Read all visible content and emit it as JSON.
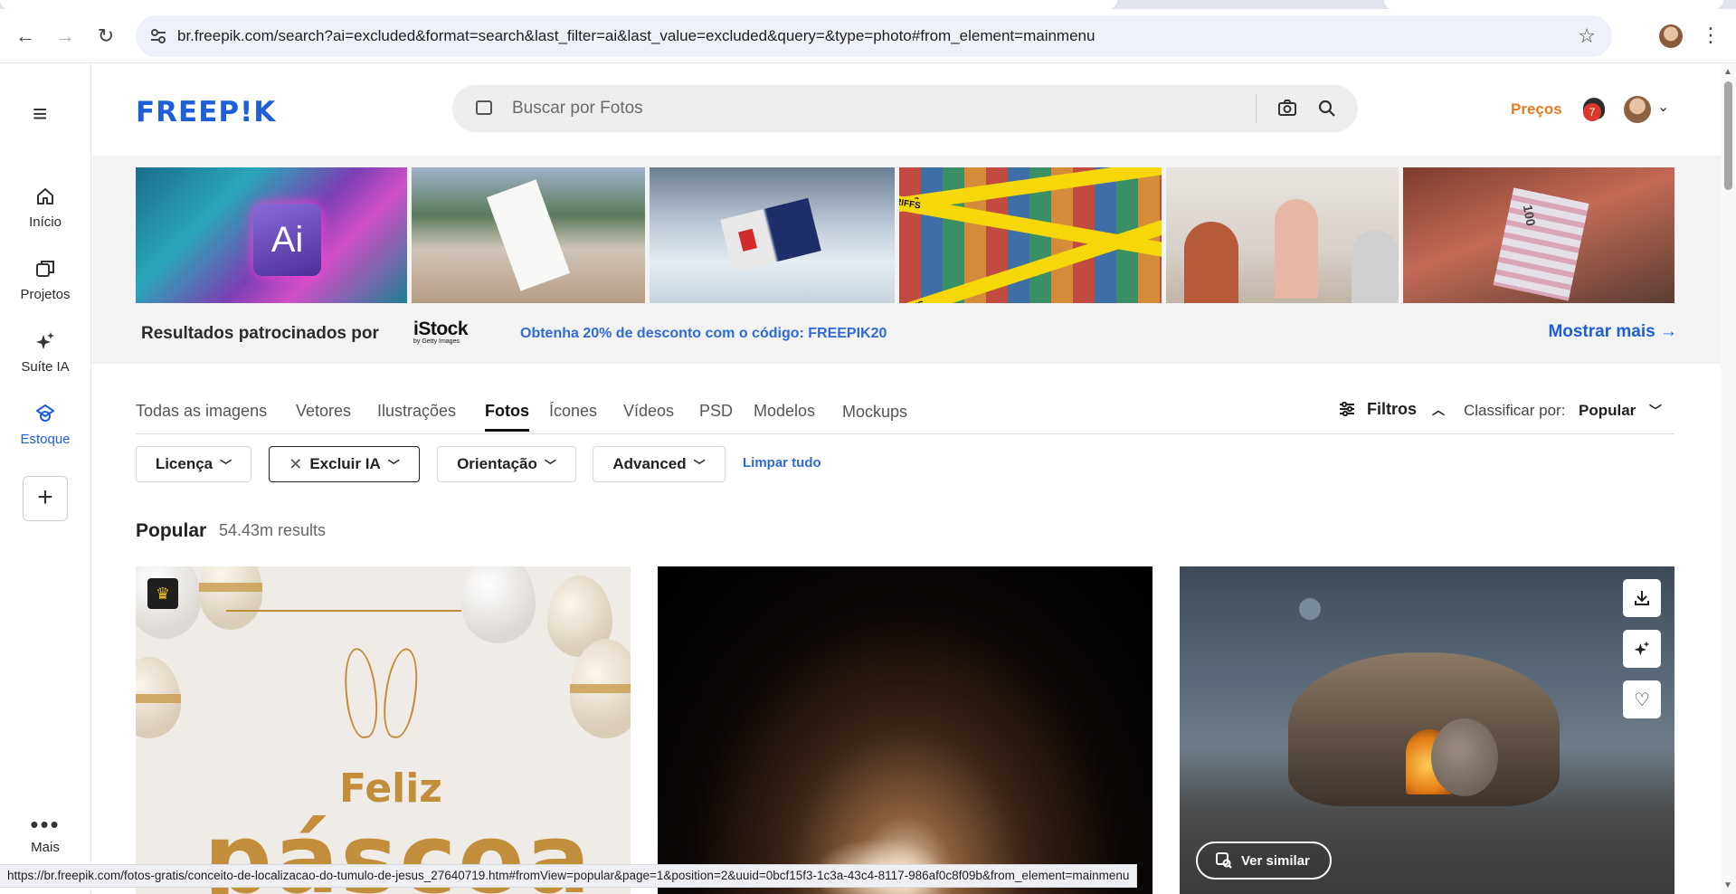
{
  "browser": {
    "url": "br.freepik.com/search?ai=excluded&format=search&last_filter=ai&last_value=excluded&query=&type=photo#from_element=mainmenu",
    "status_url": "https://br.freepik.com/fotos-gratis/conceito-de-localizacao-do-tumulo-de-jesus_27640719.htm#fromView=popular&page=1&position=2&uuid=0bcf15f3-1c3a-43c4-8117-986af0c8f09b&from_element=mainmenu",
    "icons": [
      "back-icon",
      "forward-icon",
      "reload-icon",
      "site-settings-icon",
      "bookmark-star-icon",
      "profile-icon",
      "kebab-menu-icon"
    ]
  },
  "sidebar": {
    "items": [
      {
        "label": "Início",
        "icon": "home-icon"
      },
      {
        "label": "Projetos",
        "icon": "projects-icon"
      },
      {
        "label": "Suíte IA",
        "icon": "sparkle-icon"
      },
      {
        "label": "Estoque",
        "icon": "stock-icon"
      }
    ],
    "more_label": "Mais"
  },
  "header": {
    "logo": "FREEP!K",
    "search_placeholder": "Buscar por Fotos",
    "precos": "Preços",
    "notification_count": "7"
  },
  "sponsored": {
    "label": "Resultados patrocinados por",
    "sponsor_brand": "iStock",
    "sponsor_sub": "by Getty Images",
    "promo": "Obtenha 20% de desconto com o código: FREEPIK20",
    "more": "Mostrar mais",
    "ad_text": [
      "Ai",
      "TARIFFS",
      "100"
    ]
  },
  "type_tabs": [
    {
      "label": "Todas as imagens",
      "active": false
    },
    {
      "label": "Vetores",
      "active": false
    },
    {
      "label": "Ilustrações",
      "active": false
    },
    {
      "label": "Fotos",
      "active": true
    },
    {
      "label": "Ícones",
      "active": false
    },
    {
      "label": "Vídeos",
      "active": false
    },
    {
      "label": "PSD",
      "active": false
    },
    {
      "label": "Modelos",
      "active": false
    },
    {
      "label": "Mockups",
      "active": false
    }
  ],
  "filters_bar": {
    "filtros": "Filtros",
    "sort_label": "Classificar por:",
    "sort_value": "Popular"
  },
  "filter_chips": [
    {
      "label": "Licença",
      "selected": false
    },
    {
      "label": "Excluir IA",
      "selected": true
    },
    {
      "label": "Orientação",
      "selected": false
    },
    {
      "label": "Advanced",
      "selected": false
    }
  ],
  "clear_all": "Limpar tudo",
  "results": {
    "title": "Popular",
    "count": "54.43m results"
  },
  "cards": [
    {
      "heading": "Feliz",
      "headline": "páscoa"
    },
    {},
    {
      "ver_similar": "Ver similar"
    }
  ],
  "colors": {
    "brand_blue": "#1e5fd9",
    "precos_orange": "#e97b22",
    "badge_red": "#d73a2d",
    "gold": "#c38e3c"
  }
}
